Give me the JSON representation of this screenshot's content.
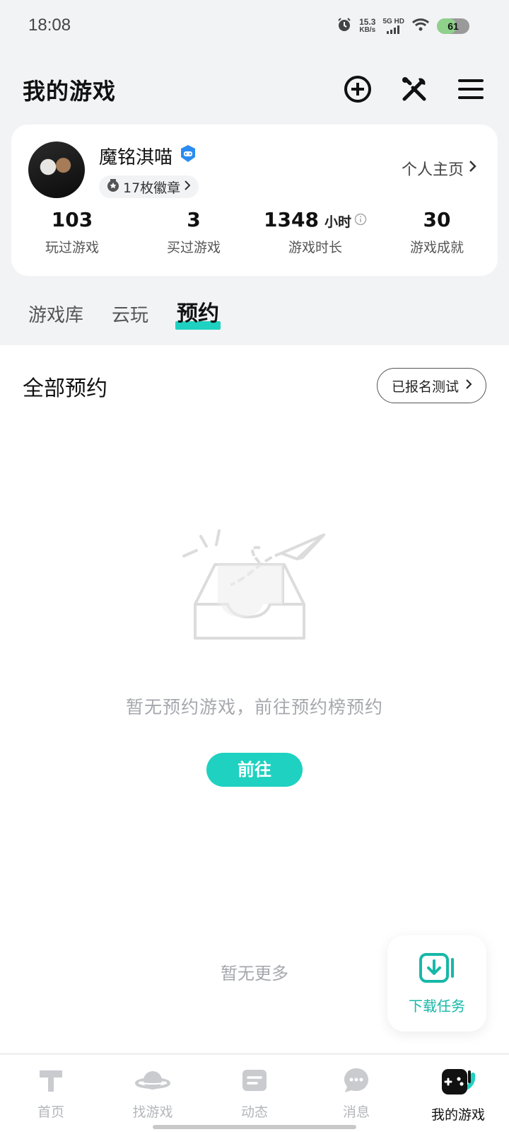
{
  "status_bar": {
    "time": "18:08",
    "net_speed_value": "15.3",
    "net_speed_unit": "KB/s",
    "net_type": "5G HD",
    "battery": "61",
    "battery_level": 0.61
  },
  "header": {
    "title": "我的游戏",
    "icons": [
      "add-circle-icon",
      "tools-icon",
      "menu-icon"
    ]
  },
  "profile": {
    "username": "魔铭淇喵",
    "badges_label": "17枚徽章",
    "profile_link": "个人主页",
    "stats": [
      {
        "value": "103",
        "unit": "",
        "label": "玩过游戏"
      },
      {
        "value": "3",
        "unit": "",
        "label": "买过游戏"
      },
      {
        "value": "1348",
        "unit": "小时",
        "label": "游戏时长"
      },
      {
        "value": "30",
        "unit": "",
        "label": "游戏成就"
      }
    ]
  },
  "tabs": [
    {
      "label": "游戏库",
      "active": false
    },
    {
      "label": "云玩",
      "active": false
    },
    {
      "label": "预约",
      "active": true
    }
  ],
  "content": {
    "section_title": "全部预约",
    "registered_tests_button": "已报名测试",
    "empty_message": "暂无预约游戏，前往预约榜预约",
    "go_button": "前往",
    "no_more": "暂无更多"
  },
  "floating": {
    "download_label": "下载任务"
  },
  "bottom_nav": [
    {
      "label": "首页",
      "icon": "home-icon",
      "active": false
    },
    {
      "label": "找游戏",
      "icon": "planet-icon",
      "active": false
    },
    {
      "label": "动态",
      "icon": "feed-icon",
      "active": false
    },
    {
      "label": "消息",
      "icon": "message-icon",
      "active": false
    },
    {
      "label": "我的游戏",
      "icon": "gamepad-icon",
      "active": true
    }
  ],
  "colors": {
    "accent": "#1ed1c0",
    "background": "#f2f3f5",
    "verified_badge": "#2a8cf0"
  }
}
